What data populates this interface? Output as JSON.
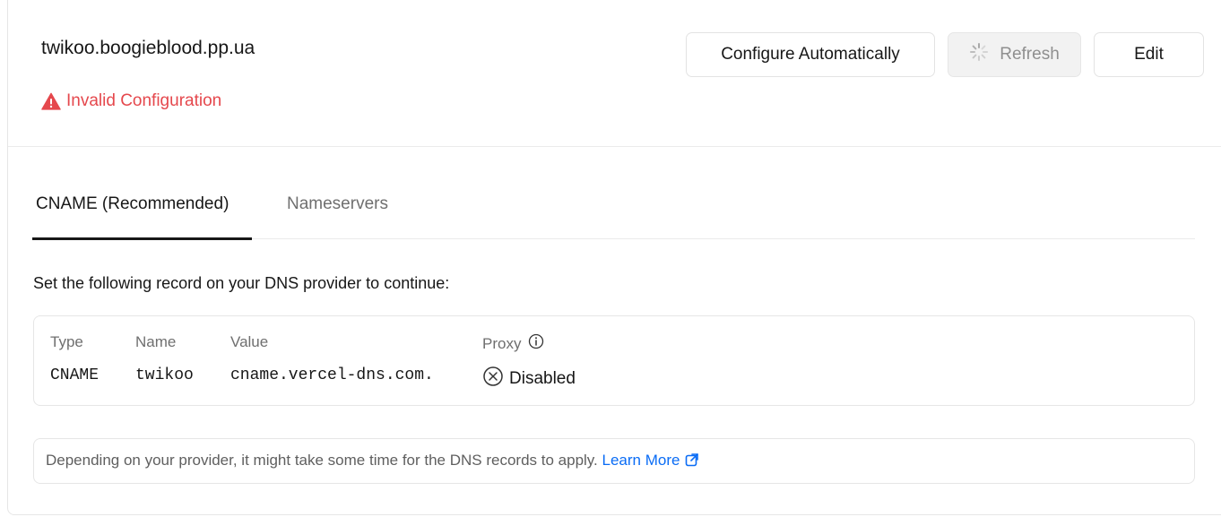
{
  "domain": {
    "name": "twikoo.boogieblood.pp.ua"
  },
  "status": {
    "text": "Invalid Configuration",
    "color": "#e5484d",
    "icon": "warning-triangle-icon"
  },
  "actions": {
    "configure_label": "Configure Automatically",
    "refresh_label": "Refresh",
    "refresh_icon": "spinner-icon",
    "edit_label": "Edit"
  },
  "tabs": [
    {
      "label": "CNAME (Recommended)",
      "active": true
    },
    {
      "label": "Nameservers",
      "active": false
    }
  ],
  "instructions": "Set the following record on your DNS provider to continue:",
  "record": {
    "headers": {
      "type": "Type",
      "name": "Name",
      "value": "Value",
      "proxy": "Proxy"
    },
    "type": "CNAME",
    "name": "twikoo",
    "value": "cname.vercel-dns.com.",
    "proxy": "Disabled",
    "proxy_info_icon": "info-circle-icon",
    "proxy_status_icon": "x-circle-icon"
  },
  "note": {
    "text": "Depending on your provider, it might take some time for the DNS records to apply.",
    "link_label": "Learn More",
    "link_icon": "external-link-icon",
    "link_color": "#0a6cf5"
  }
}
